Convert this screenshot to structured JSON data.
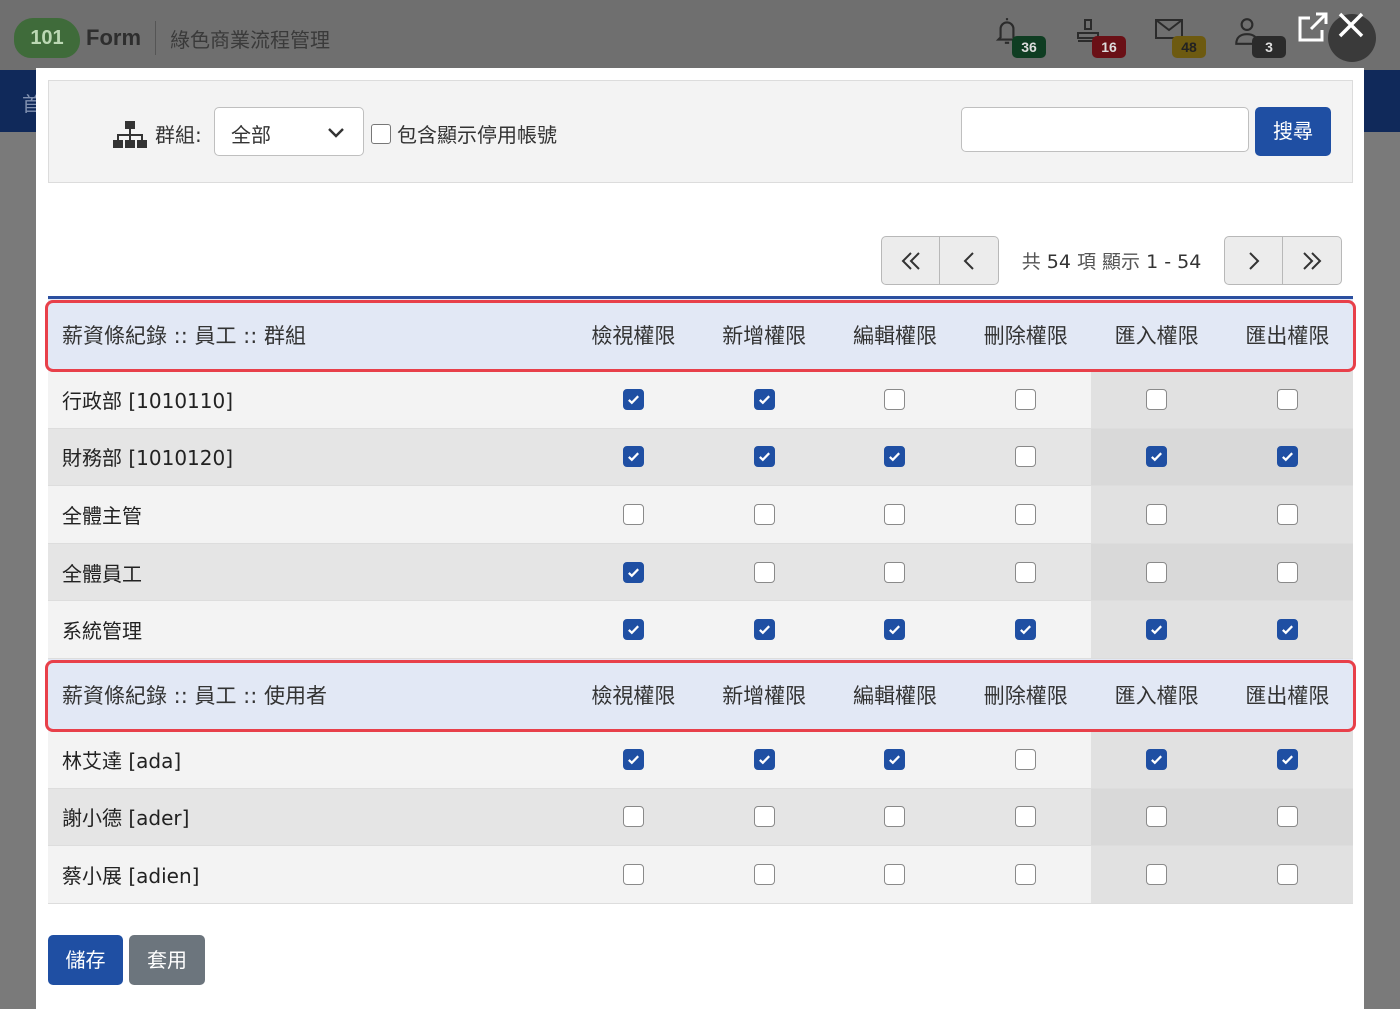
{
  "app": {
    "logo_number": "101",
    "logo_text": "Form",
    "title": "綠色商業流程管理",
    "nav_partial": "首"
  },
  "header_badges": [
    {
      "icon": "bell-icon",
      "count": "36",
      "color": "#0f3d22"
    },
    {
      "icon": "stamp-icon",
      "count": "16",
      "color": "#6a1016"
    },
    {
      "icon": "mail-icon",
      "count": "48",
      "color": "#6d5a10"
    },
    {
      "icon": "user-icon",
      "count": "3",
      "color": "#2b2b2b"
    }
  ],
  "filter": {
    "group_label": "群組:",
    "group_value": "全部",
    "include_disabled_label": "包含顯示停用帳號",
    "search_placeholder": "",
    "search_button": "搜尋"
  },
  "pager": {
    "text_total": "共",
    "total": "54",
    "text_items": "項",
    "text_showing": "顯示",
    "range": "1 - 54"
  },
  "columns": [
    "檢視權限",
    "新增權限",
    "編輯權限",
    "刪除權限",
    "匯入權限",
    "匯出權限"
  ],
  "sections": [
    {
      "title": "薪資條紀錄 :: 員工 :: 群組",
      "rows": [
        {
          "name": "行政部 [1010110]",
          "perms": [
            true,
            true,
            false,
            false,
            false,
            false
          ]
        },
        {
          "name": "財務部 [1010120]",
          "perms": [
            true,
            true,
            true,
            false,
            true,
            true
          ]
        },
        {
          "name": "全體主管",
          "perms": [
            false,
            false,
            false,
            false,
            false,
            false
          ]
        },
        {
          "name": "全體員工",
          "perms": [
            true,
            false,
            false,
            false,
            false,
            false
          ]
        },
        {
          "name": "系統管理",
          "perms": [
            true,
            true,
            true,
            true,
            true,
            true
          ]
        }
      ]
    },
    {
      "title": "薪資條紀錄 :: 員工 :: 使用者",
      "rows": [
        {
          "name": "林艾達 [ada]",
          "perms": [
            true,
            true,
            true,
            false,
            true,
            true
          ]
        },
        {
          "name": "謝小德 [ader]",
          "perms": [
            false,
            false,
            false,
            false,
            false,
            false
          ]
        },
        {
          "name": "蔡小展 [adien]",
          "perms": [
            false,
            false,
            false,
            false,
            false,
            false
          ]
        }
      ]
    }
  ],
  "footer": {
    "save": "儲存",
    "apply": "套用"
  }
}
